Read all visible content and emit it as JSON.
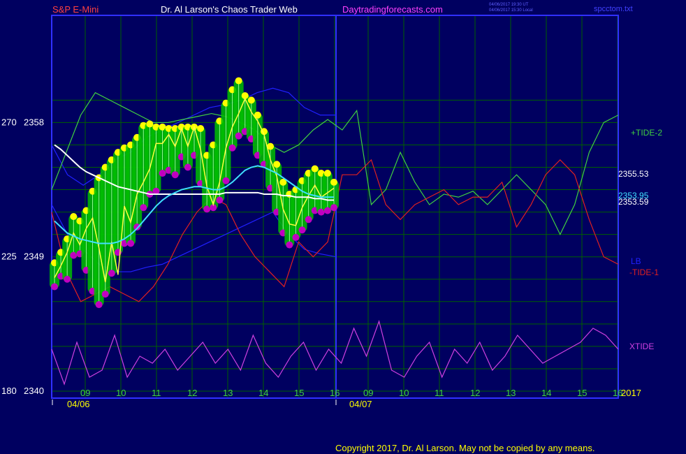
{
  "header": {
    "instrument": "S&P E-Mini",
    "site_title": "Dr. Al Larson's Chaos Trader Web",
    "site_url": "Daytradingforecasts.com",
    "timestamp_ut": "04/06/2017 19:30 UT",
    "timestamp_local": "04/06/2017 15:30 Local",
    "filename": "spcctom.txt"
  },
  "colors": {
    "background": "#000060",
    "plot_frame": "#3030ff",
    "grid": "#006000",
    "price_bar": "#00c000",
    "envelope_upper": "#2020ff",
    "moving_avg_white": "#ffffff",
    "moving_avg_cyan": "#40e0ff",
    "tide2": "#40d040",
    "tide1": "#e02020",
    "xtide": "#d040e0",
    "highs_dot": "#ffff00",
    "lows_dot": "#c000c0",
    "title_red": "#ff4040",
    "title_white": "#ffffff",
    "title_magenta": "#ff40ff"
  },
  "chart_data": {
    "type": "line",
    "price_axis": {
      "labels": [
        {
          "left": "270",
          "right": "2358",
          "value": 2358
        },
        {
          "left": "225",
          "right": "2349",
          "value": 2349
        },
        {
          "left": "180",
          "right": "2340",
          "value": 2340
        }
      ],
      "ylim": [
        2340,
        2360.5
      ]
    },
    "time_axis": {
      "day1_ticks": [
        "09",
        "10",
        "11",
        "12",
        "13",
        "14",
        "15",
        "16"
      ],
      "day2_ticks": [
        "09",
        "10",
        "11",
        "12",
        "13",
        "14",
        "15",
        "16"
      ],
      "date1": "04/06",
      "date2": "04/07",
      "year_label": "2017"
    },
    "price_readouts": [
      {
        "label": "2355.53",
        "value": 2355.53
      },
      {
        "label": "2353.95",
        "value": 2353.95
      },
      {
        "label": "2353.59",
        "value": 2353.59
      }
    ],
    "series_labels": [
      {
        "name": "+TIDE-2",
        "color": "tide2"
      },
      {
        "name": "LB",
        "color": "envelope_upper"
      },
      {
        "name": "-TIDE-1",
        "color": "tide1"
      },
      {
        "name": "XTIDE",
        "color": "xtide"
      }
    ],
    "price_close": [
      2347.6,
      2348.4,
      2349.3,
      2350.6,
      2349.8,
      2350.9,
      2351.6,
      2349.6,
      2347.3,
      2350.0,
      2347.8,
      2352.4,
      2351.3,
      2353.2,
      2354.0,
      2354.9,
      2356.6,
      2356.6,
      2357.2,
      2356.4,
      2357.6,
      2356.4,
      2357.7,
      2356.2,
      2353.7,
      2352.5,
      2354.0,
      2356.3,
      2357.7,
      2358.6,
      2359.6,
      2358.7,
      2358.1,
      2357.2,
      2355.5,
      2354.4,
      2352.2,
      2351.2,
      2351.1,
      2352.3,
      2353.1,
      2353.8,
      2353.0,
      2353.3,
      2353.6
    ],
    "price_high": [
      2348.6,
      2349.3,
      2350.2,
      2351.7,
      2351.4,
      2352.1,
      2353.4,
      2354.3,
      2355.0,
      2355.5,
      2356.0,
      2356.3,
      2356.5,
      2357.0,
      2357.8,
      2357.9,
      2357.7,
      2357.7,
      2357.6,
      2357.6,
      2357.7,
      2357.7,
      2357.7,
      2357.6,
      2355.8,
      2356.5,
      2358.1,
      2359.3,
      2360.2,
      2360.8,
      2359.8,
      2359.5,
      2358.5,
      2357.4,
      2356.4,
      2355.2,
      2354.0,
      2353.2,
      2353.5,
      2354.1,
      2354.6,
      2354.9,
      2354.6,
      2354.6,
      2354.0
    ],
    "price_low": [
      2347.0,
      2347.7,
      2347.5,
      2349.1,
      2349.2,
      2348.1,
      2346.7,
      2345.8,
      2346.5,
      2347.9,
      2349.3,
      2349.9,
      2349.9,
      2351.0,
      2352.3,
      2353.2,
      2353.4,
      2354.6,
      2354.8,
      2354.5,
      2355.7,
      2355.0,
      2355.8,
      2353.9,
      2352.2,
      2352.3,
      2352.8,
      2354.1,
      2356.3,
      2357.1,
      2357.4,
      2356.9,
      2355.8,
      2355.2,
      2353.6,
      2352.0,
      2350.6,
      2349.8,
      2350.3,
      2350.8,
      2351.5,
      2352.1,
      2352.0,
      2352.1,
      2352.3
    ],
    "moving_avg_white": [
      2356.5,
      2356.2,
      2355.8,
      2355.4,
      2355.0,
      2354.7,
      2354.5,
      2354.3,
      2354.1,
      2353.9,
      2353.7,
      2353.6,
      2353.5,
      2353.4,
      2353.3,
      2353.2,
      2353.2,
      2353.2,
      2353.2,
      2353.2,
      2353.2,
      2353.2,
      2353.2,
      2353.2,
      2353.2,
      2353.2,
      2353.2,
      2353.3,
      2353.3,
      2353.3,
      2353.3,
      2353.3,
      2353.3,
      2353.2,
      2353.2,
      2353.2,
      2353.1,
      2353.1,
      2353.0,
      2353.0,
      2353.0,
      2352.9,
      2352.9,
      2352.8,
      2352.8
    ],
    "moving_avg_cyan": [
      2351.4,
      2351.0,
      2350.6,
      2350.4,
      2350.2,
      2350.1,
      2350.0,
      2349.9,
      2349.9,
      2349.9,
      2350.0,
      2350.2,
      2350.5,
      2350.9,
      2351.4,
      2351.9,
      2352.4,
      2352.8,
      2353.1,
      2353.3,
      2353.5,
      2353.6,
      2353.7,
      2353.7,
      2353.6,
      2353.5,
      2353.5,
      2353.7,
      2354.0,
      2354.4,
      2354.8,
      2355.0,
      2355.1,
      2355.0,
      2354.8,
      2354.6,
      2354.3,
      2354.0,
      2353.7,
      2353.4,
      2353.2,
      2353.1,
      2353.0,
      2353.0,
      2353.0
    ],
    "tide2": [
      2353.5,
      2356.0,
      2358.5,
      2360.0,
      2359.5,
      2359.0,
      2358.5,
      2358.0,
      2358.0,
      2358.2,
      2358.4,
      2358.6,
      2358.4,
      2358.0,
      2357.5,
      2356.5,
      2356.0,
      2356.5,
      2357.5,
      2358.2,
      2357.5,
      2358.8,
      2352.5,
      2353.5,
      2356.0,
      2354.0,
      2352.5,
      2353.2,
      2353.0,
      2353.4,
      2352.5,
      2353.5,
      2354.5,
      2353.5,
      2352.5,
      2350.5,
      2352.5,
      2356.0,
      2358.0,
      2358.5
    ],
    "tide1": [
      2352.0,
      2348.0,
      2346.0,
      2346.5,
      2347.0,
      2346.5,
      2346.0,
      2347.0,
      2348.5,
      2350.5,
      2352.0,
      2353.0,
      2352.5,
      2350.5,
      2349.0,
      2348.0,
      2347.0,
      2350.0,
      2349.0,
      2350.0,
      2354.5,
      2354.5,
      2355.5,
      2352.5,
      2351.5,
      2352.5,
      2353.0,
      2353.5,
      2352.5,
      2353.0,
      2353.0,
      2354.0,
      2351.0,
      2352.5,
      2354.5,
      2355.5,
      2354.5,
      2351.5,
      2349.0,
      2348.5
    ],
    "envelope_upper": [
      2356.5,
      2354.5,
      2353.8,
      2354.5,
      2355.5,
      2356.0,
      2357.0,
      2357.5,
      2358.0,
      2358.5,
      2359.0,
      2359.2,
      2359.5,
      2360.0,
      2360.3,
      2360.0,
      2359.0,
      2358.5,
      2358.5
    ],
    "envelope_lower": [
      2352.5,
      2350.5,
      2349.5,
      2348.5,
      2348.0,
      2348.0,
      2348.3,
      2348.5,
      2349.0,
      2349.5,
      2350.0,
      2350.5,
      2351.0,
      2351.5,
      2352.0,
      2350.5,
      2349.5,
      2349.2,
      2349.0
    ],
    "xtide": [
      0.6,
      0.1,
      0.7,
      0.2,
      0.3,
      0.8,
      0.2,
      0.5,
      0.4,
      0.6,
      0.3,
      0.5,
      0.7,
      0.4,
      0.6,
      0.3,
      0.8,
      0.4,
      0.2,
      0.5,
      0.7,
      0.3,
      0.6,
      0.4,
      0.9,
      0.5,
      1.0,
      0.3,
      0.2,
      0.5,
      0.7,
      0.2,
      0.6,
      0.4,
      0.7,
      0.3,
      0.5,
      0.8,
      0.6,
      0.4,
      0.5,
      0.6,
      0.7,
      0.9,
      0.8,
      0.6
    ],
    "xlim": [
      8.5,
      17.0
    ],
    "grid": true
  },
  "footer": {
    "copyright": "Copyright 2017, Dr. Al Larson. May not be copied by any means."
  }
}
